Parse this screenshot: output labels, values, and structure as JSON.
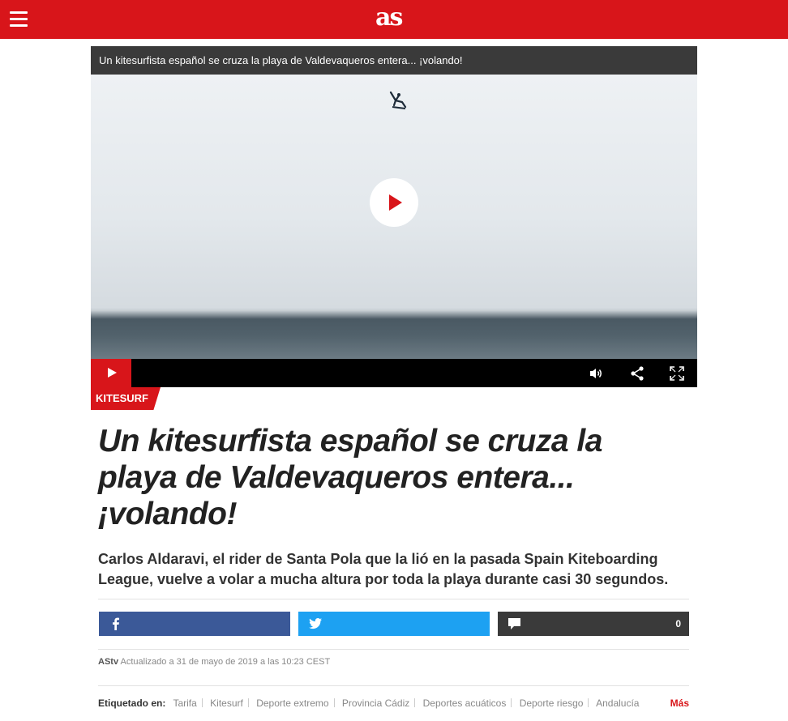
{
  "brand": {
    "logo": "as",
    "accent": "#d8151a"
  },
  "video": {
    "title": "Un kitesurfista español se cruza la playa de Valdevaqueros entera... ¡volando!"
  },
  "section_tag": "KITESURF",
  "article": {
    "headline": "Un kitesurfista español se cruza la playa de Valdevaqueros entera... ¡volando!",
    "subheadline": "Carlos Aldaravi, el rider de Santa Pola que la lió en la pasada Spain Kiteboarding League, vuelve a volar a mucha altura por toda la playa durante casi 30 segundos.",
    "author": "AStv",
    "updated": "Actualizado a 31 de mayo de 2019 a las 10:23 CEST"
  },
  "share": {
    "facebook_color": "#3b5998",
    "twitter_color": "#1da1f2",
    "comments_count": "0"
  },
  "tags": {
    "label": "Etiquetado en:",
    "items": [
      "Tarifa",
      "Kitesurf",
      "Deporte extremo",
      "Provincia Cádiz",
      "Deportes acuáticos",
      "Deporte riesgo",
      "Andalucía"
    ],
    "more": "Más"
  },
  "icons": [
    "menu-icon",
    "play-icon",
    "volume-icon",
    "share-icon",
    "fullscreen-icon",
    "facebook-icon",
    "twitter-icon",
    "comment-icon"
  ]
}
